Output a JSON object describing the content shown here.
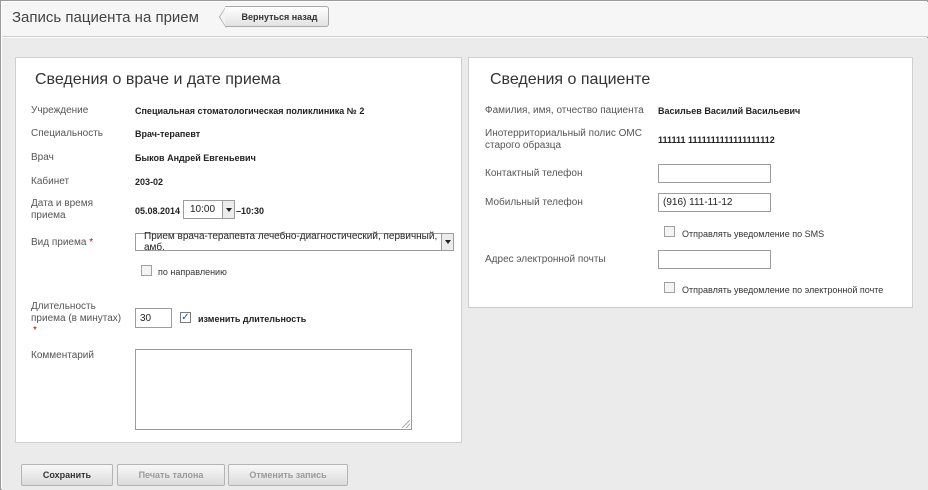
{
  "header": {
    "title": "Запись пациента на прием",
    "back_label": "Вернуться назад"
  },
  "doctor_panel": {
    "title": "Сведения о враче и дате приема",
    "institution_label": "Учреждение",
    "institution_value": "Специальная стоматологическая поликлиника № 2",
    "specialty_label": "Специальность",
    "specialty_value": "Врач-терапевт",
    "doctor_label": "Врач",
    "doctor_value": "Быков Андрей Евгеньевич",
    "cabinet_label": "Кабинет",
    "cabinet_value": "203-02",
    "datetime_label": "Дата и время приема",
    "date_value": "05.08.2014",
    "time_value": "10:00",
    "end_time_value": "–10:30",
    "visit_type_label": "Вид приема",
    "required_mark": "*",
    "visit_type_value": "Прием врача-терапевта лечебно-диагностический, первичный, амб.",
    "referral_label": "по направлению",
    "duration_label": "Длительность приема (в минутах)",
    "duration_value": "30",
    "change_duration_label": "изменить длительность",
    "comment_label": "Комментарий",
    "comment_value": ""
  },
  "patient_panel": {
    "title": "Сведения о пациенте",
    "name_label": "Фамилия, имя, отчество пациента",
    "name_value": "Васильев Василий Васильевич",
    "policy_label": "Инотерриториальный полис ОМС старого образца",
    "policy_value": "111111 1111111111111111112",
    "contact_phone_label": "Контактный телефон",
    "contact_phone_value": "",
    "mobile_phone_label": "Мобильный телефон",
    "mobile_phone_value": "(916) 111-11-12",
    "sms_label": "Отправлять уведомление по SMS",
    "email_label": "Адрес электронной почты",
    "email_value": "",
    "email_notify_label": "Отправлять уведомление по электронной почте"
  },
  "footer": {
    "save_label": "Сохранить",
    "print_label": "Печать талона",
    "cancel_label": "Отменить запись"
  },
  "colors": {
    "background": "#ebebeb",
    "panel": "#ffffff",
    "required": "#cc0000"
  }
}
